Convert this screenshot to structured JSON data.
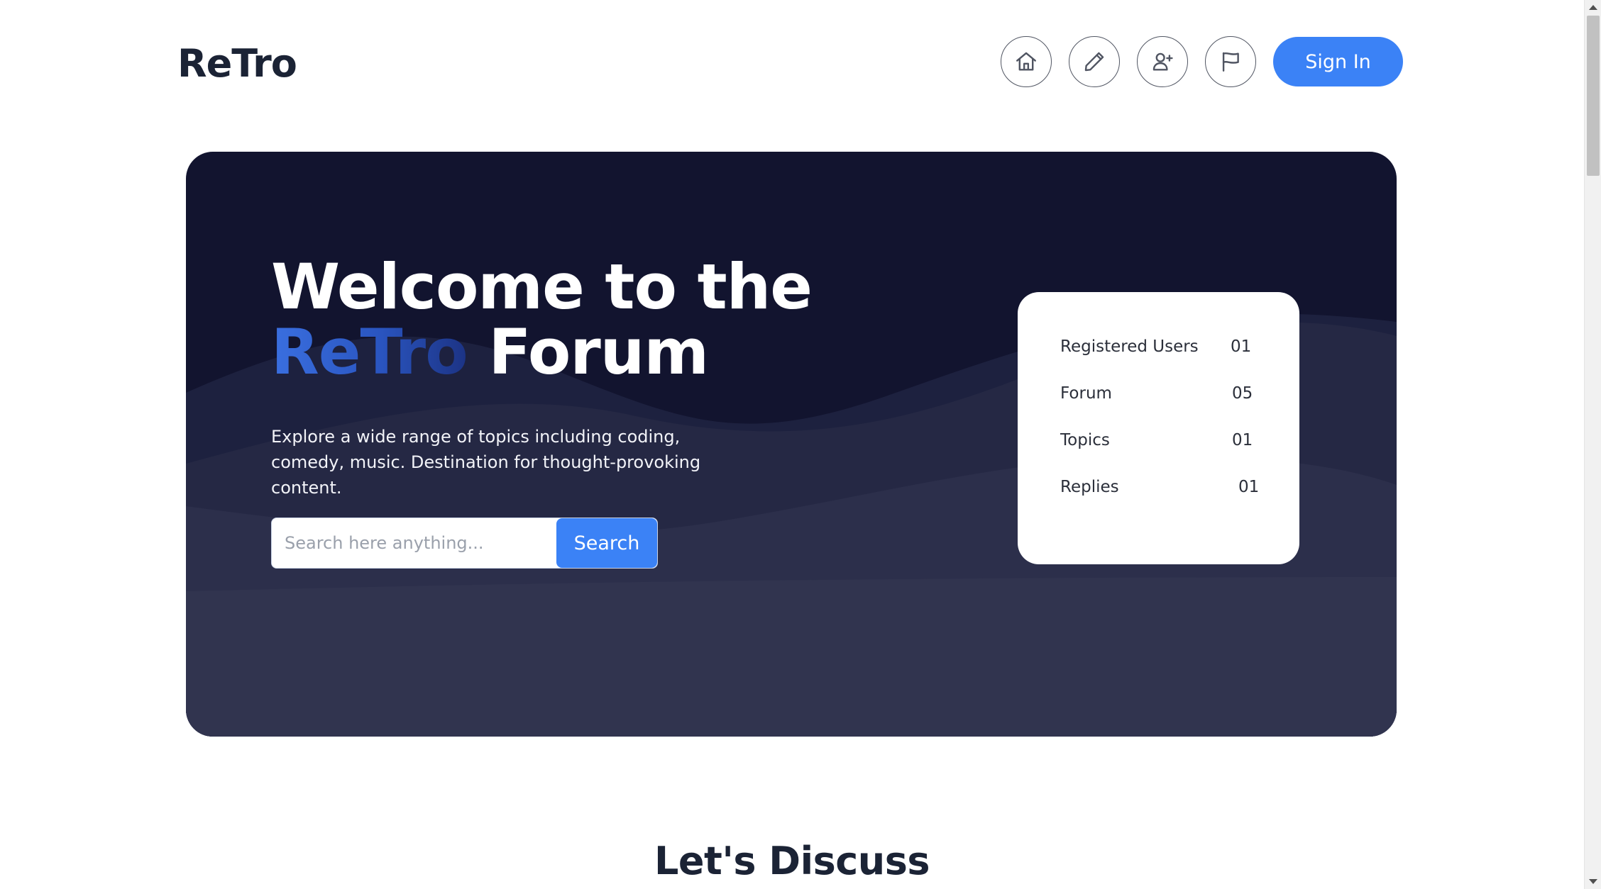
{
  "header": {
    "logo": "ReTro",
    "nav": [
      {
        "name": "home",
        "icon": "home-icon"
      },
      {
        "name": "edit",
        "icon": "pencil-icon"
      },
      {
        "name": "add-user",
        "icon": "user-plus-icon"
      },
      {
        "name": "report",
        "icon": "flag-icon"
      }
    ],
    "signin_label": "Sign In"
  },
  "hero": {
    "title_line1": "Welcome to the",
    "title_brand": "ReTro",
    "title_rest": "Forum",
    "description": "Explore a wide range of topics including coding, comedy, music. Destination for thought-provoking content.",
    "search_placeholder": "Search here anything...",
    "search_button": "Search"
  },
  "stats": [
    {
      "label": "Registered Users",
      "value": "01"
    },
    {
      "label": "Forum",
      "value": "05"
    },
    {
      "label": "Topics",
      "value": "01"
    },
    {
      "label": "Replies",
      "value": "01"
    }
  ],
  "section": {
    "title": "Let's Discuss"
  },
  "colors": {
    "accent": "#3b82f6",
    "hero_bg": "#12142f",
    "heading": "#1b2335"
  }
}
